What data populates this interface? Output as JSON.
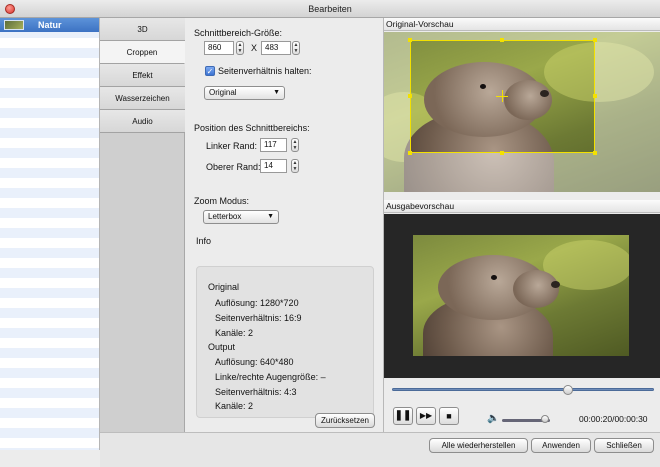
{
  "window": {
    "title": "Bearbeiten"
  },
  "file_list": {
    "items": [
      {
        "label": "Natur"
      }
    ]
  },
  "tabs": [
    {
      "label": "3D"
    },
    {
      "label": "Croppen"
    },
    {
      "label": "Effekt"
    },
    {
      "label": "Wasserzeichen"
    },
    {
      "label": "Audio"
    }
  ],
  "active_tab": "Croppen",
  "crop": {
    "size_label": "Schnittbereich-Größe:",
    "width": "860",
    "x_sep": "X",
    "height": "483",
    "keep_ratio_label": "Seitenverhältnis halten:",
    "keep_ratio_checked": true,
    "ratio_select": "Original",
    "position_label": "Position des Schnittbereichs:",
    "left_label": "Linker Rand:",
    "left_value": "117",
    "top_label": "Oberer Rand:",
    "top_value": "14",
    "zoom_label": "Zoom Modus:",
    "zoom_select": "Letterbox"
  },
  "info": {
    "title": "Info",
    "original_heading": "Original",
    "original_resolution": "Auflösung: 1280*720",
    "original_aspect": "Seitenverhältnis: 16:9",
    "original_channels": "Kanäle: 2",
    "output_heading": "Output",
    "output_resolution": "Auflösung: 640*480",
    "output_eye": "Linke/rechte Augengröße: –",
    "output_aspect": "Seitenverhältnis: 4:3",
    "output_channels": "Kanäle: 2"
  },
  "reset_button": "Zurücksetzen",
  "preview": {
    "original_title": "Original-Vorschau",
    "output_title": "Ausgabevorschau"
  },
  "player": {
    "time": "00:00:20/00:00:30",
    "progress": 0.67,
    "volume": 0.9
  },
  "bottom": {
    "restore_all": "Alle wiederherstellen",
    "apply": "Anwenden",
    "close": "Schließen"
  },
  "colors": {
    "crop_frame": "#f3e100",
    "selection": "#3c72c3"
  },
  "icons": {
    "pause": "pause-icon",
    "forward": "fast-forward-icon",
    "stop": "stop-icon",
    "volume": "speaker-icon",
    "close": "close-window-icon"
  }
}
